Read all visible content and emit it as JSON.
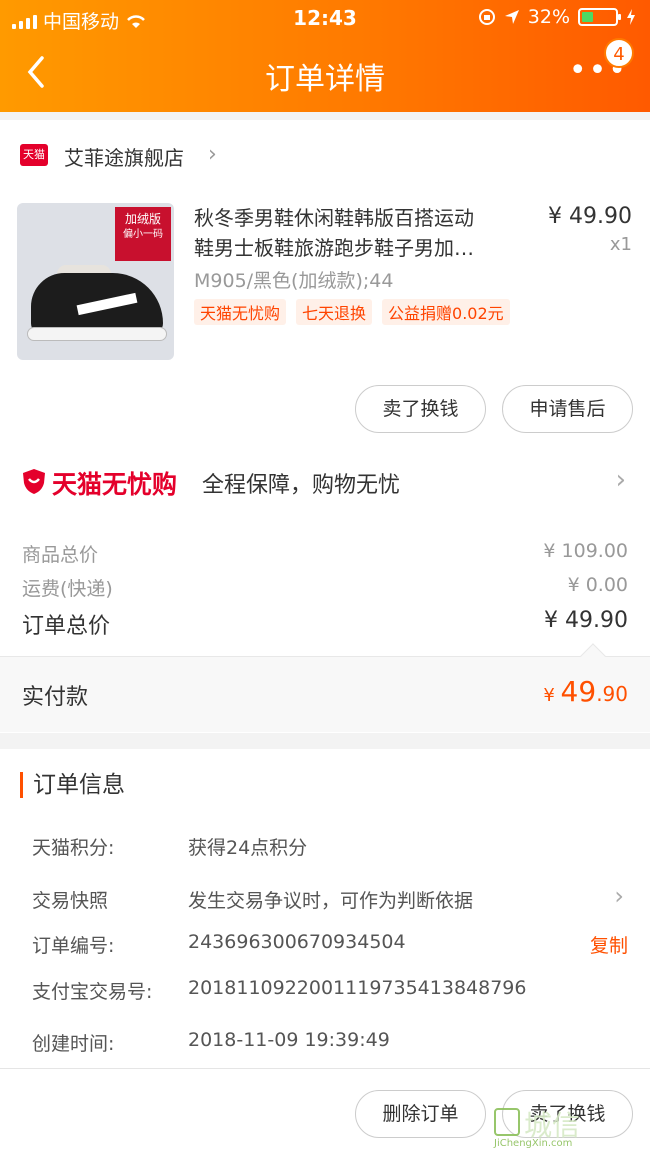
{
  "status": {
    "carrier": "中国移动",
    "time": "12:43",
    "battery": "32%"
  },
  "nav": {
    "title": "订单详情",
    "badge": "4"
  },
  "store": {
    "logo_text": "天猫",
    "name": "艾菲途旗舰店"
  },
  "product": {
    "title_line1": "秋冬季男鞋休闲鞋韩版百搭运动",
    "title_line2": "鞋男士板鞋旅游跑步鞋子男加…",
    "price": "¥ 49.90",
    "qty": "x1",
    "sku": "M905/黑色(加绒款);44",
    "tags": [
      "天猫无忧购",
      "七天退换",
      "公益捐赠0.02元"
    ],
    "image_tag_line1": "加绒版",
    "image_tag_line2": "偏小一码"
  },
  "item_buttons": {
    "sell": "卖了换钱",
    "aftersale": "申请售后"
  },
  "guarantee": {
    "brand": "天猫无忧购",
    "desc": "全程保障，购物无忧"
  },
  "costs": {
    "goods_label": "商品总价",
    "goods_value": "¥ 109.00",
    "shipping_label": "运费(快递)",
    "shipping_value": "¥ 0.00",
    "total_label": "订单总价",
    "total_value": "¥ 49.90",
    "paid_label": "实付款",
    "paid_currency": "¥ ",
    "paid_int": "49",
    "paid_dec": ".90"
  },
  "order_info": {
    "title": "订单信息",
    "points_label": "天猫积分:",
    "points_value": "获得24点积分",
    "snapshot_label": "交易快照",
    "snapshot_value": "发生交易争议时，可作为判断依据",
    "order_no_label": "订单编号:",
    "order_no_value": "243696300670934504",
    "copy": "复制",
    "alipay_label": "支付宝交易号:",
    "alipay_value": "2018110922001119735413848796",
    "created_label": "创建时间:",
    "created_value": "2018-11-09 19:39:49"
  },
  "footer": {
    "delete": "删除订单",
    "sell": "卖了换钱"
  },
  "watermark": {
    "text": "JiChengXin.com"
  },
  "colors": {
    "header": "#ff7a00",
    "accent": "#ff5000",
    "tmall_red": "#e4002b"
  }
}
